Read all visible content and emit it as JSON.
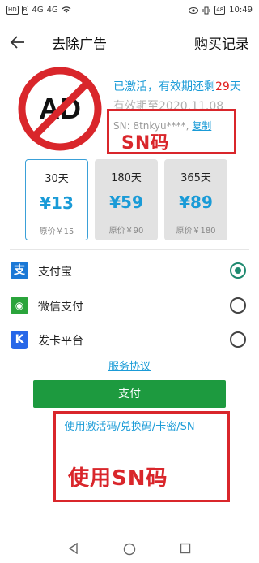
{
  "status_bar": {
    "left_icons": [
      "HD",
      "B",
      "4G",
      "4G",
      "wifi-icon"
    ],
    "battery": "48",
    "time": "10:49"
  },
  "header": {
    "title": "去除广告",
    "purchase_record": "购买记录"
  },
  "ad_icon": {
    "text": "AD"
  },
  "activation": {
    "activated_prefix": "已激活，有效期还剩",
    "days_left": "29",
    "days_suffix": "天",
    "expire": "有效期至2020.11.08",
    "sn_text": "SN: 8tnkyu****,",
    "copy_label": "复制",
    "annotation": "SN码"
  },
  "plans": [
    {
      "duration": "30天",
      "price": "¥13",
      "original": "原价￥15",
      "selected": true
    },
    {
      "duration": "180天",
      "price": "¥59",
      "original": "原价￥90",
      "selected": false
    },
    {
      "duration": "365天",
      "price": "¥89",
      "original": "原价￥180",
      "selected": false
    }
  ],
  "payment_methods": [
    {
      "label": "支付宝",
      "icon": "alipay-icon",
      "glyph": "支",
      "color": "#1a78d6",
      "selected": true
    },
    {
      "label": "微信支付",
      "icon": "wechat-icon",
      "glyph": "◉",
      "color": "#2aa43b",
      "selected": false
    },
    {
      "label": "发卡平台",
      "icon": "card-platform-icon",
      "glyph": "K",
      "color": "#2767e8",
      "selected": false
    }
  ],
  "service_agreement": "服务协议",
  "pay_button": "支付",
  "use_code_link": "使用激活码/兑换码/卡密/SN",
  "use_sn_annotation": "使用SN码",
  "colors": {
    "accent": "#1a9bd7",
    "pay_button": "#1d9a3f",
    "annotation_red": "#d9262b",
    "radio_selected": "#1f8a70"
  }
}
